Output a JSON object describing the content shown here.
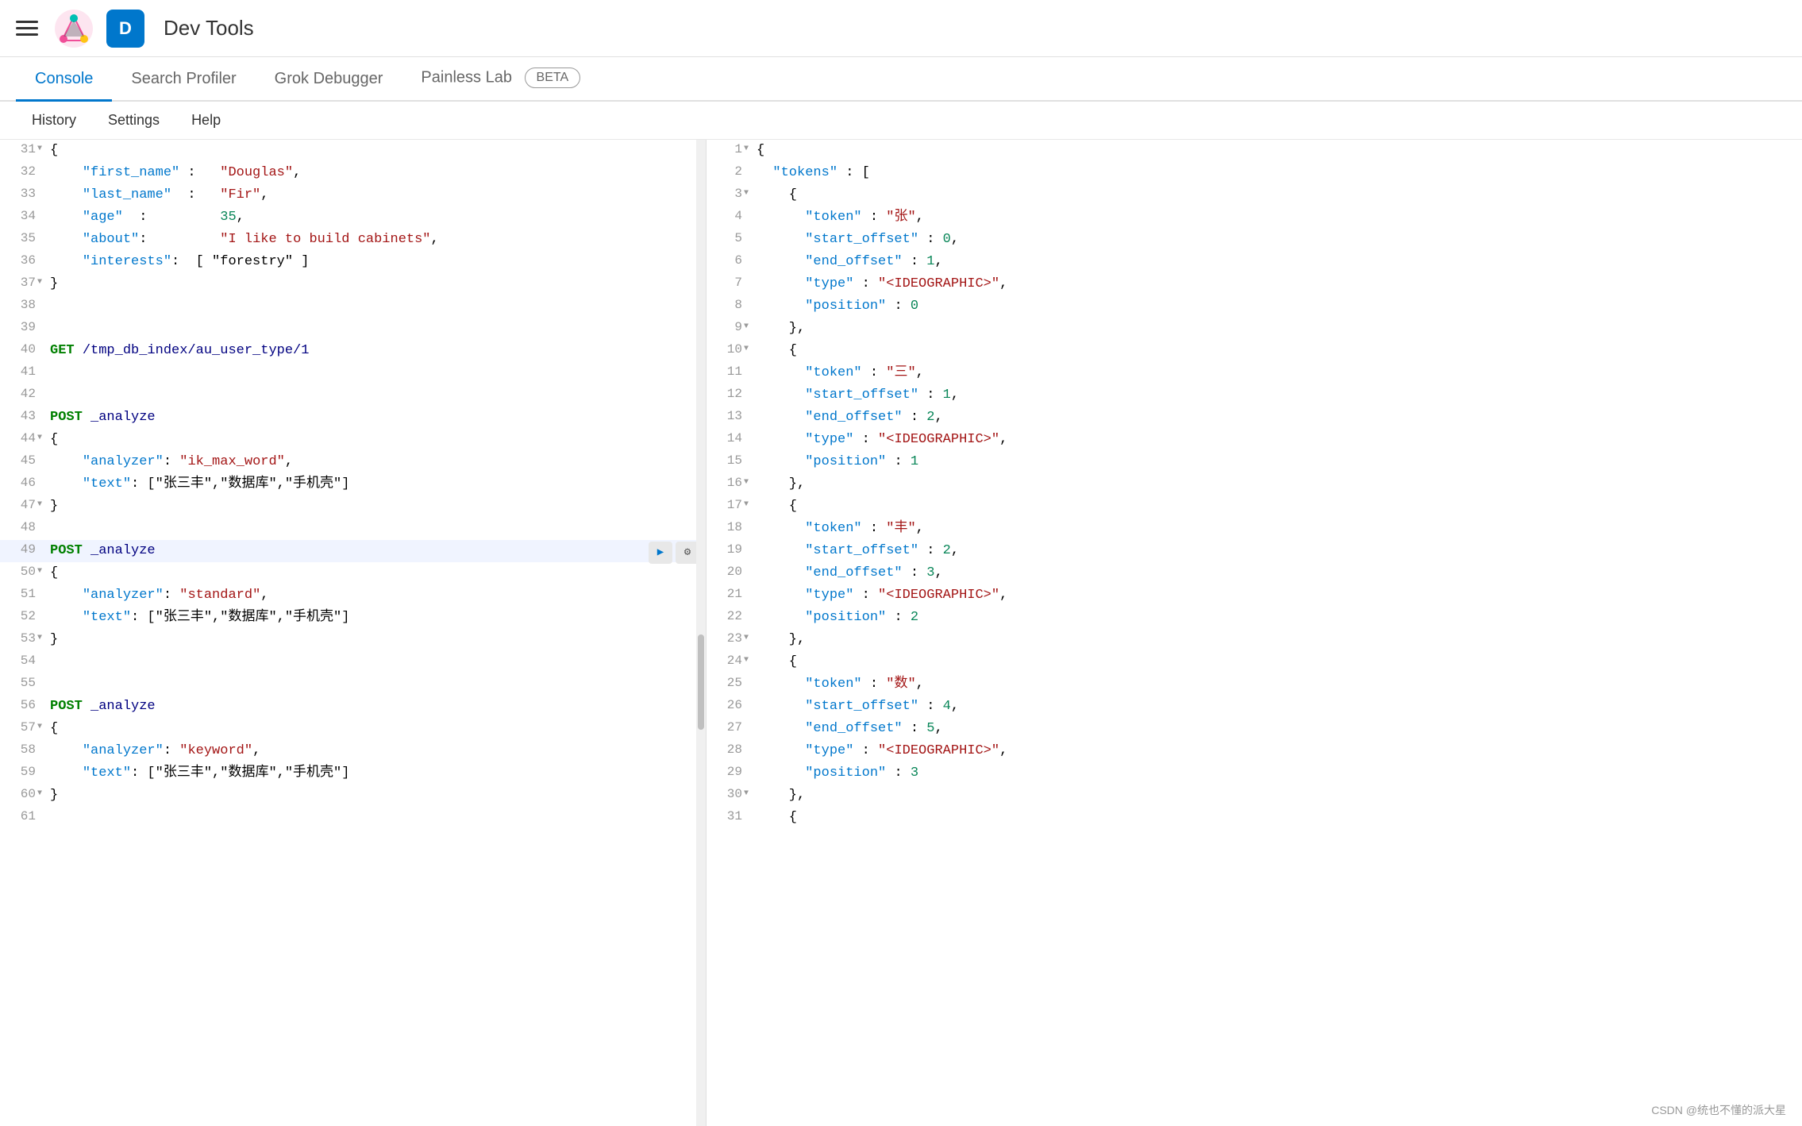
{
  "topbar": {
    "app_icon_letter": "D",
    "app_title": "Dev Tools"
  },
  "nav": {
    "tabs": [
      {
        "label": "Console",
        "active": true
      },
      {
        "label": "Search Profiler",
        "active": false
      },
      {
        "label": "Grok Debugger",
        "active": false
      },
      {
        "label": "Painless Lab",
        "active": false
      },
      {
        "beta_label": "BETA"
      }
    ]
  },
  "secondary_nav": {
    "items": [
      "History",
      "Settings",
      "Help"
    ]
  },
  "editor": {
    "lines": [
      {
        "num": "31",
        "fold": true,
        "content": "{",
        "type": "plain"
      },
      {
        "num": "32",
        "content": "    \"first_name\" :   \"Douglas\",",
        "type": "mixed"
      },
      {
        "num": "33",
        "content": "    \"last_name\"  :   \"Fir\",",
        "type": "mixed"
      },
      {
        "num": "34",
        "content": "    \"age\"  :         35,",
        "type": "mixed"
      },
      {
        "num": "35",
        "content": "    \"about\":         \"I like to build cabinets\",",
        "type": "mixed"
      },
      {
        "num": "36",
        "content": "    \"interests\":  [ \"forestry\" ]",
        "type": "mixed"
      },
      {
        "num": "37",
        "fold": true,
        "content": "}",
        "type": "plain"
      },
      {
        "num": "38",
        "content": "",
        "type": "plain"
      },
      {
        "num": "39",
        "content": "",
        "type": "plain"
      },
      {
        "num": "40",
        "content": "GET /tmp_db_index/au_user_type/1",
        "type": "http"
      },
      {
        "num": "41",
        "content": "",
        "type": "plain"
      },
      {
        "num": "42",
        "content": "",
        "type": "plain"
      },
      {
        "num": "43",
        "content": "POST _analyze",
        "type": "http"
      },
      {
        "num": "44",
        "fold": true,
        "content": "{",
        "type": "plain"
      },
      {
        "num": "45",
        "content": "    \"analyzer\": \"ik_max_word\",",
        "type": "mixed"
      },
      {
        "num": "46",
        "content": "    \"text\": [\"张三丰\",\"数据库\",\"手机壳\"]",
        "type": "mixed"
      },
      {
        "num": "47",
        "fold": true,
        "content": "}",
        "type": "plain"
      },
      {
        "num": "48",
        "content": "",
        "type": "plain"
      },
      {
        "num": "49",
        "content": "POST _analyze",
        "type": "http",
        "active": true,
        "show_actions": true
      },
      {
        "num": "50",
        "fold": true,
        "content": "{",
        "type": "plain"
      },
      {
        "num": "51",
        "content": "    \"analyzer\": \"standard\",",
        "type": "mixed"
      },
      {
        "num": "52",
        "content": "    \"text\": [\"张三丰\",\"数据库\",\"手机壳\"]",
        "type": "mixed"
      },
      {
        "num": "53",
        "fold": true,
        "content": "}",
        "type": "plain"
      },
      {
        "num": "54",
        "content": "",
        "type": "plain"
      },
      {
        "num": "55",
        "content": "",
        "type": "plain"
      },
      {
        "num": "56",
        "content": "POST _analyze",
        "type": "http"
      },
      {
        "num": "57",
        "fold": true,
        "content": "{",
        "type": "plain"
      },
      {
        "num": "58",
        "content": "    \"analyzer\": \"keyword\",",
        "type": "mixed"
      },
      {
        "num": "59",
        "content": "    \"text\": [\"张三丰\",\"数据库\",\"手机壳\"]",
        "type": "mixed"
      },
      {
        "num": "60",
        "fold": true,
        "content": "}",
        "type": "plain"
      },
      {
        "num": "61",
        "content": "",
        "type": "plain"
      }
    ]
  },
  "response": {
    "lines": [
      {
        "num": "1",
        "fold": true,
        "content": "{"
      },
      {
        "num": "2",
        "content": "  \"tokens\" : ["
      },
      {
        "num": "3",
        "fold": true,
        "content": "    {"
      },
      {
        "num": "4",
        "content": "      \"token\" : \"张\","
      },
      {
        "num": "5",
        "content": "      \"start_offset\" : 0,"
      },
      {
        "num": "6",
        "content": "      \"end_offset\" : 1,"
      },
      {
        "num": "7",
        "content": "      \"type\" : \"<IDEOGRAPHIC>\","
      },
      {
        "num": "8",
        "content": "      \"position\" : 0"
      },
      {
        "num": "9",
        "fold": true,
        "content": "    },"
      },
      {
        "num": "10",
        "fold": true,
        "content": "    {"
      },
      {
        "num": "11",
        "content": "      \"token\" : \"三\","
      },
      {
        "num": "12",
        "content": "      \"start_offset\" : 1,"
      },
      {
        "num": "13",
        "content": "      \"end_offset\" : 2,"
      },
      {
        "num": "14",
        "content": "      \"type\" : \"<IDEOGRAPHIC>\","
      },
      {
        "num": "15",
        "content": "      \"position\" : 1"
      },
      {
        "num": "16",
        "fold": true,
        "content": "    },"
      },
      {
        "num": "17",
        "fold": true,
        "content": "    {"
      },
      {
        "num": "18",
        "content": "      \"token\" : \"丰\","
      },
      {
        "num": "19",
        "content": "      \"start_offset\" : 2,"
      },
      {
        "num": "20",
        "content": "      \"end_offset\" : 3,"
      },
      {
        "num": "21",
        "content": "      \"type\" : \"<IDEOGRAPHIC>\","
      },
      {
        "num": "22",
        "content": "      \"position\" : 2"
      },
      {
        "num": "23",
        "fold": true,
        "content": "    },"
      },
      {
        "num": "24",
        "fold": true,
        "content": "    {"
      },
      {
        "num": "25",
        "content": "      \"token\" : \"数\","
      },
      {
        "num": "26",
        "content": "      \"start_offset\" : 4,"
      },
      {
        "num": "27",
        "content": "      \"end_offset\" : 5,"
      },
      {
        "num": "28",
        "content": "      \"type\" : \"<IDEOGRAPHIC>\","
      },
      {
        "num": "29",
        "content": "      \"position\" : 3"
      },
      {
        "num": "30",
        "fold": true,
        "content": "    },"
      },
      {
        "num": "31",
        "content": "    {"
      }
    ]
  },
  "icons": {
    "hamburger": "☰",
    "run": "▶",
    "wrench": "🔧",
    "fold_closed": "▶",
    "fold_open": "▼"
  },
  "watermark": "CSDN @统也不懂的派大星"
}
